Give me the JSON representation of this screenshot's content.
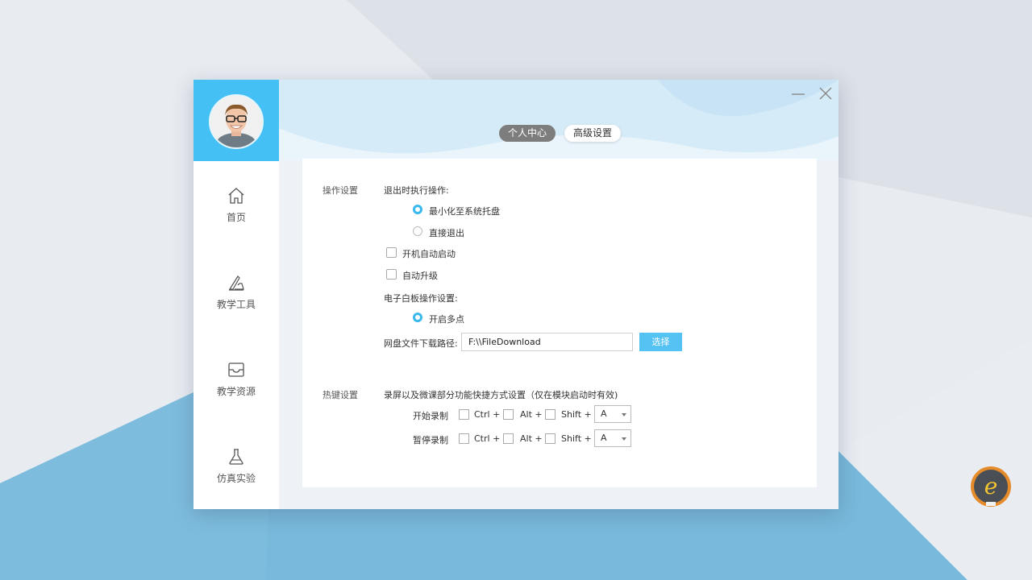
{
  "window": {
    "tabs": {
      "active": "个人中心",
      "inactive": "高级设置"
    }
  },
  "sidebar": {
    "items": [
      {
        "label": "首页",
        "icon": "home-icon"
      },
      {
        "label": "教学工具",
        "icon": "tools-icon"
      },
      {
        "label": "教学资源",
        "icon": "inbox-icon"
      },
      {
        "label": "仿真实验",
        "icon": "flask-icon"
      }
    ]
  },
  "operation": {
    "section_label": "操作设置",
    "exit_label": "退出时执行操作:",
    "exit_options": [
      {
        "label": "最小化至系统托盘",
        "selected": true
      },
      {
        "label": "直接退出",
        "selected": false
      }
    ],
    "autostart_label": "开机自动启动",
    "autoupgrade_label": "自动升级",
    "whiteboard_label": "电子白板操作设置:",
    "multipoint_label": "开启多点",
    "download_label": "网盘文件下载路径:",
    "download_path": "F:\\\\FileDownload",
    "choose_label": "选择"
  },
  "hotkeys": {
    "section_label": "热键设置",
    "description": "录屏以及微课部分功能快捷方式设置（仅在模块启动时有效)",
    "rows": [
      {
        "label": "开始录制",
        "ctrl": "Ctrl +",
        "alt": "Alt +",
        "shift": "Shift +",
        "key": "A"
      },
      {
        "label": "暂停录制",
        "ctrl": "Ctrl +",
        "alt": "Alt +",
        "shift": "Shift +",
        "key": "A"
      }
    ]
  },
  "colors": {
    "accent": "#44c0f5",
    "button": "#54c2f3",
    "tab_active": "#7d7d7d",
    "background_blue": "#7fbcdc"
  },
  "logo": {
    "letter": "e"
  }
}
